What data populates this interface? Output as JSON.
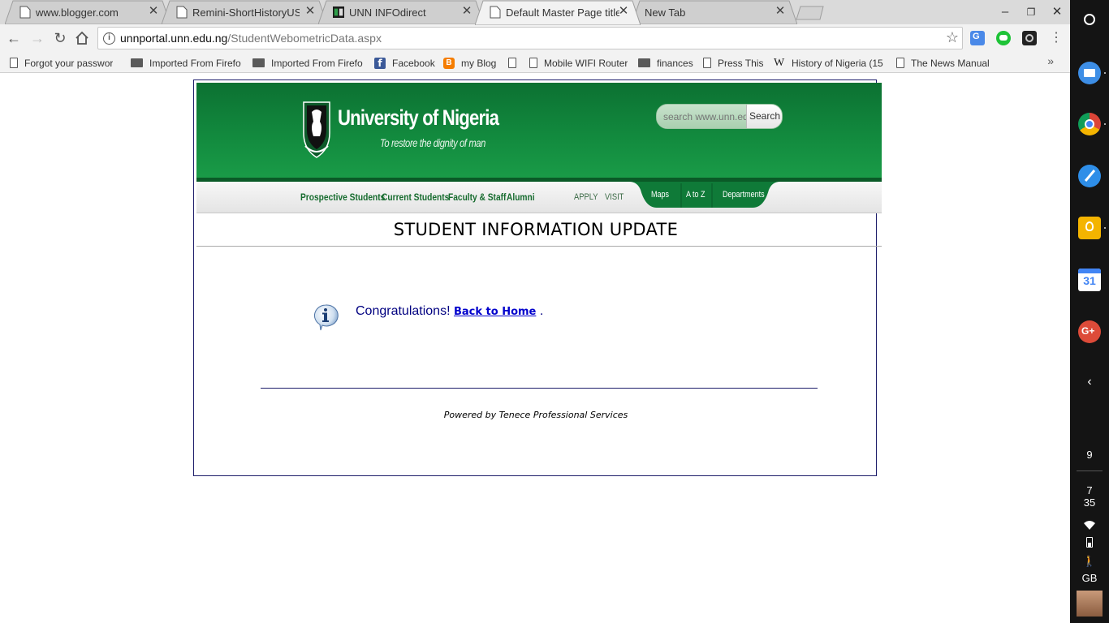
{
  "tabs": [
    {
      "title": "www.blogger.com",
      "icon": "page-icon"
    },
    {
      "title": "Remini-ShortHistoryUSA",
      "icon": "page-icon"
    },
    {
      "title": "UNN INFOdirect",
      "icon": "unn-favicon"
    },
    {
      "title": "Default Master Page title",
      "icon": "page-icon",
      "active": true
    },
    {
      "title": "New Tab",
      "icon": "none"
    }
  ],
  "address": {
    "host": "unnportal.unn.edu.ng",
    "path": "/StudentWebometricData.aspx"
  },
  "bookmarks": [
    {
      "label": "Forgot your passwor",
      "icon": "page"
    },
    {
      "label": "Imported From Firefo",
      "icon": "folder"
    },
    {
      "label": "Imported From Firefo",
      "icon": "folder"
    },
    {
      "label": "Facebook",
      "icon": "facebook"
    },
    {
      "label": "my Blog",
      "icon": "blogger"
    },
    {
      "label": "",
      "icon": "page"
    },
    {
      "label": "Mobile WIFI Router",
      "icon": "page"
    },
    {
      "label": "finances",
      "icon": "folder"
    },
    {
      "label": "Press This",
      "icon": "page"
    },
    {
      "label": "History of Nigeria (15",
      "icon": "wikipedia"
    },
    {
      "label": "The News Manual",
      "icon": "page"
    }
  ],
  "site": {
    "name": "University of Nigeria",
    "motto": "To restore the dignity of man",
    "search_placeholder": "search www.unn.edu.ng",
    "search_button": "Search",
    "nav": [
      "Prospective Students",
      "Current Students",
      "Faculty & Staff",
      "Alumni"
    ],
    "nav_light": [
      "APPLY",
      "VISIT"
    ],
    "nav_tabs": [
      "Maps",
      "A to Z",
      "Departments"
    ]
  },
  "page": {
    "title": "STUDENT INFORMATION UPDATE",
    "message": "Congratulations!",
    "link": "Back to Home",
    "message_end": " .",
    "footer": "Powered by Tenece Professional Services"
  },
  "tray": {
    "notifications": "9",
    "time_hour": "7",
    "time_min": "35",
    "ime": "GB"
  },
  "colors": {
    "unn_green": "#128a3e",
    "link": "#0000cc",
    "message": "#000080"
  }
}
